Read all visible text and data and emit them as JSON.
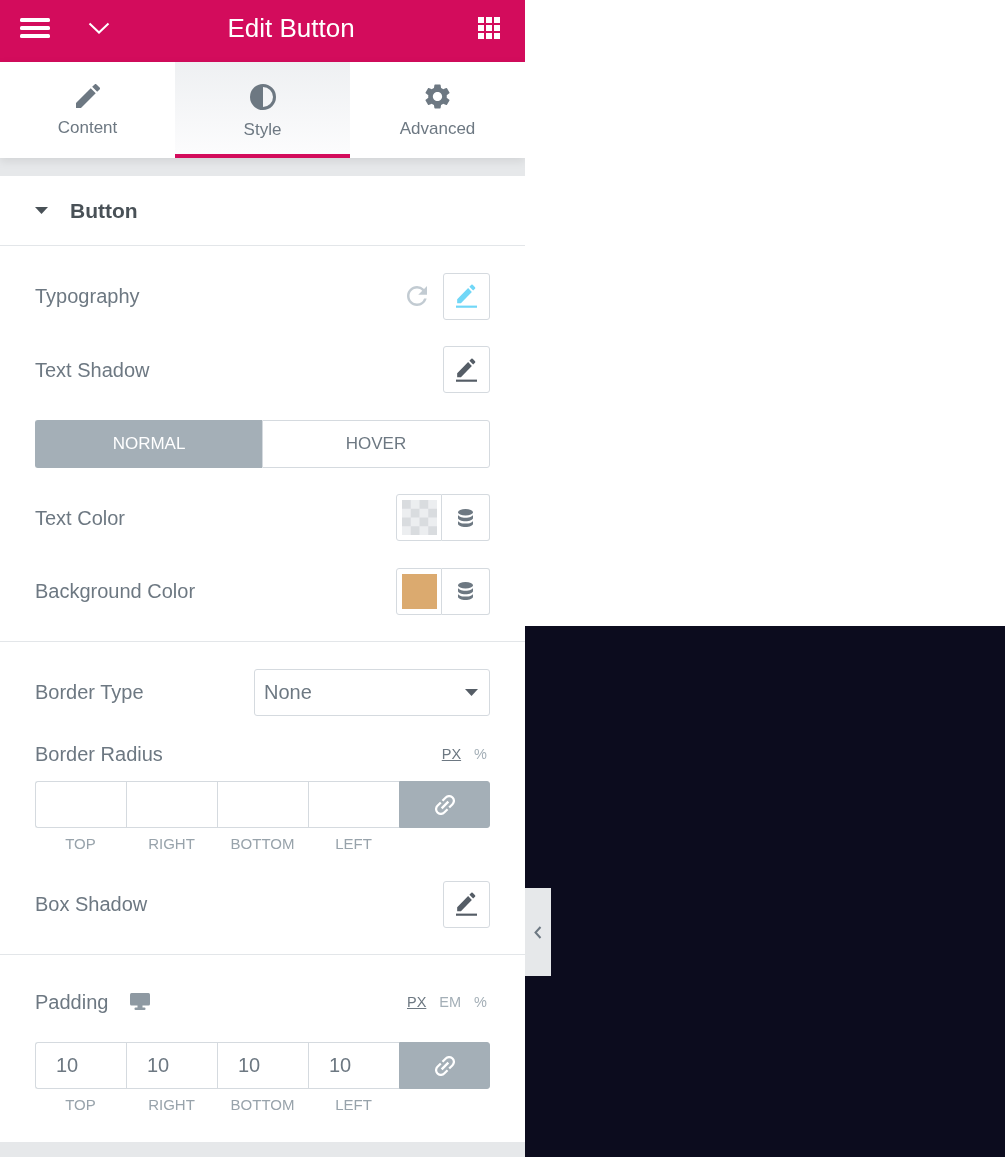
{
  "header": {
    "title": "Edit Button"
  },
  "tabs": [
    {
      "label": "Content",
      "selected": false
    },
    {
      "label": "Style",
      "selected": true
    },
    {
      "label": "Advanced",
      "selected": false
    }
  ],
  "section": {
    "title": "Button",
    "expanded": true
  },
  "groups": [
    {
      "controls": [
        {
          "kind": "popover",
          "label": "Typography",
          "modified": true
        },
        {
          "kind": "popover",
          "label": "Text Shadow",
          "modified": false
        },
        {
          "kind": "state_tabs",
          "tabs": [
            {
              "label": "NORMAL",
              "selected": true
            },
            {
              "label": "HOVER",
              "selected": false
            }
          ]
        },
        {
          "kind": "color",
          "label": "Text Color"
        },
        {
          "kind": "color",
          "label": "Background Color",
          "color": "#dbaa6f"
        }
      ]
    },
    {
      "controls": [
        {
          "kind": "select",
          "label": "Border Type",
          "value": "None"
        },
        {
          "kind": "dimensions",
          "label": "Border Radius",
          "responsive": false,
          "units": [
            {
              "label": "PX",
              "selected": true
            },
            {
              "label": "%",
              "selected": false
            }
          ],
          "fields": [
            {
              "label": "TOP"
            },
            {
              "label": "RIGHT"
            },
            {
              "label": "BOTTOM"
            },
            {
              "label": "LEFT"
            }
          ],
          "linked": true
        },
        {
          "kind": "popover",
          "label": "Box Shadow",
          "modified": false
        }
      ]
    },
    {
      "controls": [
        {
          "kind": "dimensions",
          "label": "Padding",
          "responsive": true,
          "units": [
            {
              "label": "PX",
              "selected": true
            },
            {
              "label": "EM",
              "selected": false
            },
            {
              "label": "%",
              "selected": false
            }
          ],
          "fields": [
            {
              "label": "TOP",
              "value": "10"
            },
            {
              "label": "RIGHT",
              "value": "10"
            },
            {
              "label": "BOTTOM",
              "value": "10"
            },
            {
              "label": "LEFT",
              "value": "10"
            }
          ],
          "linked": true
        }
      ]
    }
  ]
}
